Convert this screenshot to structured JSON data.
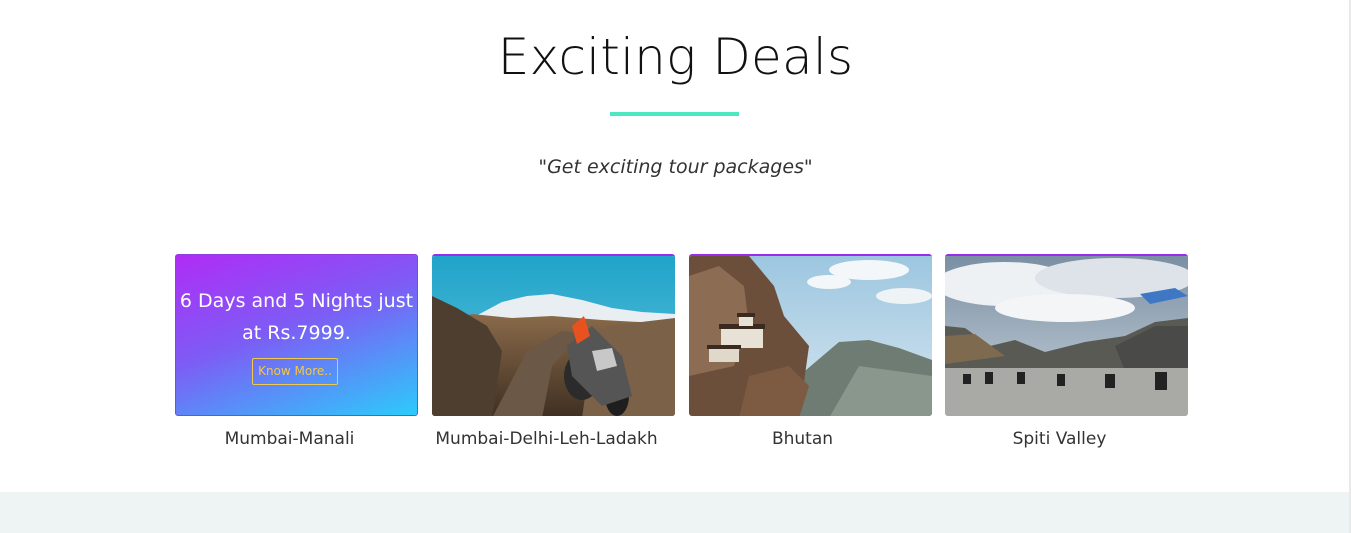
{
  "section": {
    "title": "Exciting Deals",
    "subtitle": "\"Get exciting tour packages\""
  },
  "promo": {
    "text": "6 Days and 5 Nights just at Rs.7999.",
    "button_label": "Know More.."
  },
  "cards": [
    {
      "label": "Mumbai-Manali",
      "image": "promo-gradient"
    },
    {
      "label": "Mumbai-Delhi-Leh-Ladakh",
      "image": "motorbike-mountain-road"
    },
    {
      "label": "Bhutan",
      "image": "cliff-monastery"
    },
    {
      "label": "Spiti Valley",
      "image": "riders-on-plateau"
    }
  ],
  "colors": {
    "accent_underline": "#4de8c2",
    "promo_gradient_start": "#b02cf6",
    "promo_gradient_end": "#2ccbfb",
    "promo_button": "#f5c842"
  }
}
